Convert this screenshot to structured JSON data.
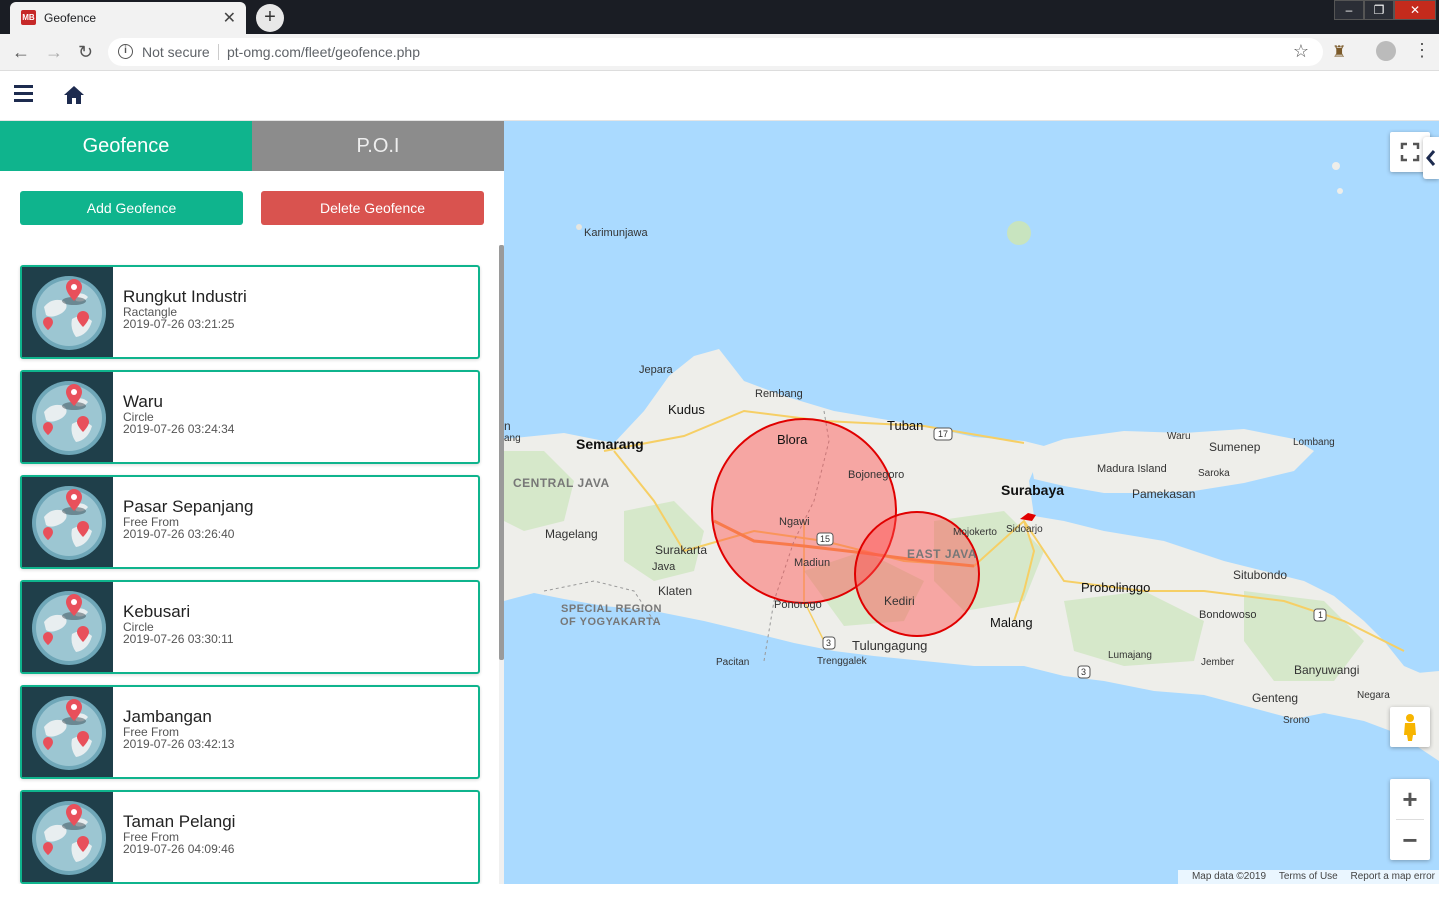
{
  "browser": {
    "tab_title": "Geofence",
    "tab_favicon_text": "MB",
    "security_text": "Not secure",
    "url": "pt-omg.com/fleet/geofence.php"
  },
  "sidebar": {
    "tabs": [
      {
        "label": "Geofence",
        "active": true
      },
      {
        "label": "P.O.I",
        "active": false
      }
    ],
    "add_button": "Add Geofence",
    "delete_button": "Delete Geofence",
    "items": [
      {
        "name": "Rungkut Industri",
        "type": "Ractangle",
        "date": "2019-07-26 03:21:25"
      },
      {
        "name": "Waru",
        "type": "Circle",
        "date": "2019-07-26 03:24:34"
      },
      {
        "name": "Pasar Sepanjang",
        "type": "Free From",
        "date": "2019-07-26 03:26:40"
      },
      {
        "name": "Kebusari",
        "type": "Circle",
        "date": "2019-07-26 03:30:11"
      },
      {
        "name": "Jambangan",
        "type": "Free From",
        "date": "2019-07-26 03:42:13"
      },
      {
        "name": "Taman Pelangi",
        "type": "Free From",
        "date": "2019-07-26 04:09:46"
      }
    ]
  },
  "map": {
    "labels": {
      "karimunjawa": "Karimunjawa",
      "jepara": "Jepara",
      "kudus": "Kudus",
      "rembang": "Rembang",
      "semarang": "Semarang",
      "blora": "Blora",
      "tuban": "Tuban",
      "bojonegoro": "Bojonegoro",
      "central_java": "CENTRAL JAVA",
      "ngawi": "Ngawi",
      "surabaya": "Surabaya",
      "madura": "Madura Island",
      "pamekasan": "Pamekasan",
      "sumenep": "Sumenep",
      "waru": "Waru",
      "lombang": "Lombang",
      "saroka": "Saroka",
      "mojokerto": "Mojokerto",
      "sidoarjo": "Sidoarjo",
      "magelang": "Magelang",
      "surakarta": "Surakarta",
      "java": "Java",
      "madiun": "Madiun",
      "east_java": "EAST JAVA",
      "klaten": "Klaten",
      "probolinggo": "Probolinggo",
      "situbondo": "Situbondo",
      "special_region_1": "SPECIAL REGION",
      "special_region_2": "OF YOGYAKARTA",
      "ponorogo": "Ponorogo",
      "kediri": "Kediri",
      "malang": "Malang",
      "bondowoso": "Bondowoso",
      "tulungagung": "Tulungagung",
      "pacitan": "Pacitan",
      "trenggalek": "Trenggalek",
      "lumajang": "Lumajang",
      "jember": "Jember",
      "banyuwangi": "Banyuwangi",
      "genteng": "Genteng",
      "negara": "Negara",
      "srono": "Srono",
      "edge_n": "n",
      "edge_ang": "ang",
      "road_15": "15",
      "road_17": "17",
      "road_1": "1",
      "road_3a": "3",
      "road_3b": "3"
    },
    "attribution": {
      "data": "Map data ©2019",
      "terms": "Terms of Use",
      "report": "Report a map error"
    },
    "zoom_in": "+",
    "zoom_out": "−"
  }
}
